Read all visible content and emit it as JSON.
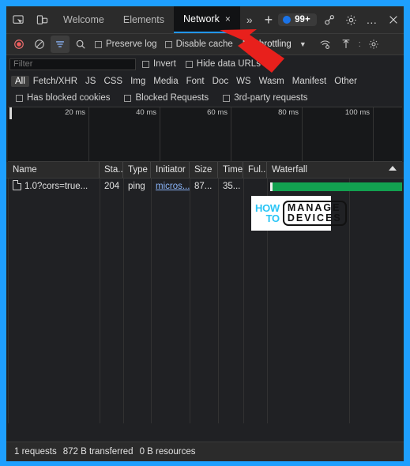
{
  "window": {
    "border_color": "#1e9fff",
    "background": "#202124"
  },
  "tabbar": {
    "inspect_icon": "inspect-element-icon",
    "device_icon": "device-toolbar-icon",
    "tabs": [
      {
        "label": "Welcome",
        "active": false
      },
      {
        "label": "Elements",
        "active": false
      },
      {
        "label": "Network",
        "active": true,
        "close": "×"
      }
    ],
    "more_tabs": "»",
    "add_tab": "+",
    "issues_badge": {
      "count": "99+",
      "dot_color": "#1a73e8"
    },
    "icons": [
      {
        "name": "extensions-icon",
        "glyph": "share"
      },
      {
        "name": "settings-gear-icon",
        "glyph": "gear"
      },
      {
        "name": "more-options-icon",
        "glyph": "…"
      },
      {
        "name": "close-devtools-icon",
        "glyph": "✕"
      }
    ]
  },
  "toolbar": {
    "record_label": "record-button",
    "clear_label": "clear-button",
    "filter_label": "filter-button",
    "search_label": "search-button",
    "preserve_log": "Preserve log",
    "disable_cache": "Disable cache",
    "throttling": "No throttling",
    "caret": "▼",
    "network_conditions": "network-conditions-icon",
    "import_har": "import-har-icon",
    "divider": ":",
    "settings": "network-settings-icon"
  },
  "filter": {
    "placeholder": "Filter",
    "value": "",
    "invert": "Invert",
    "hide_data_urls": "Hide data URLs",
    "categories": [
      "All",
      "Fetch/XHR",
      "JS",
      "CSS",
      "Img",
      "Media",
      "Font",
      "Doc",
      "WS",
      "Wasm",
      "Manifest",
      "Other"
    ],
    "selected_category": "All",
    "options": [
      "Has blocked cookies",
      "Blocked Requests",
      "3rd-party requests"
    ]
  },
  "overview": {
    "ticks": [
      "20 ms",
      "40 ms",
      "60 ms",
      "80 ms",
      "100 ms"
    ]
  },
  "table": {
    "columns": [
      "Name",
      "Sta...",
      "Type",
      "Initiator",
      "Size",
      "Time",
      "Ful...",
      "Waterfall"
    ],
    "sort_indicator": "▲",
    "rows": [
      {
        "name": "1.0?cors=true...",
        "status": "204",
        "type": "ping",
        "initiator": "micros...",
        "size": "87...",
        "time": "35...",
        "fulfilled": "",
        "waterfall_color": "#12a150"
      }
    ]
  },
  "watermark": {
    "line1": "HOW",
    "line2": "TO",
    "line3": "MANAGE",
    "line4": "DEVICES",
    "accent": "#29c5f6"
  },
  "statusbar": {
    "requests": "1 requests",
    "transferred": "872 B transferred",
    "resources": "0 B resources"
  },
  "annotation": {
    "arrow_color": "#e8201c"
  }
}
